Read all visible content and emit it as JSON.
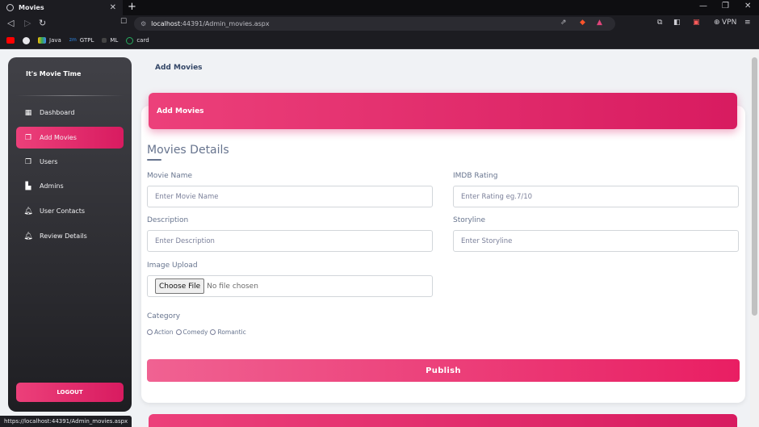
{
  "browser": {
    "tab_title": "Movies",
    "tab_close": "✕",
    "new_tab": "+",
    "url_host": "localhost",
    "url_path": ":44391/Admin_movies.aspx",
    "vpn_label": "VPN",
    "bookmarks": [
      "Java",
      "GTPL",
      "ML",
      "card"
    ],
    "status_url": "https://localhost:44391/Admin_movies.aspx"
  },
  "sidebar": {
    "brand": "It's Movie Time",
    "items": [
      {
        "label": "Dashboard",
        "icon": "dashboard-icon",
        "active": false
      },
      {
        "label": "Add Movies",
        "icon": "add-movies-icon",
        "active": true
      },
      {
        "label": "Users",
        "icon": "users-icon",
        "active": false
      },
      {
        "label": "Admins",
        "icon": "admins-icon",
        "active": false
      },
      {
        "label": "User Contacts",
        "icon": "bell-icon",
        "active": false
      },
      {
        "label": "Review Details",
        "icon": "bell-icon",
        "active": false
      }
    ],
    "logout": "LOGOUT"
  },
  "page": {
    "title": "Add Movies",
    "card_header": "Add Movies",
    "section_title": "Movies Details"
  },
  "form": {
    "movie_name": {
      "label": "Movie Name",
      "placeholder": "Enter Movie Name"
    },
    "imdb_rating": {
      "label": "IMDB Rating",
      "placeholder": "Enter Rating eg.7/10"
    },
    "description": {
      "label": "Description",
      "placeholder": "Enter Description"
    },
    "storyline": {
      "label": "Storyline",
      "placeholder": "Enter Storyline"
    },
    "image_upload": {
      "label": "Image Upload",
      "button": "Choose File",
      "status": "No file chosen"
    },
    "category": {
      "label": "Category",
      "options": [
        "Action",
        "Comedy",
        "Romantic"
      ]
    },
    "publish": "Publish"
  },
  "colors": {
    "accent": "#e91e63",
    "sidebar_dark": "#1e1e22",
    "text_muted": "#67748e"
  }
}
